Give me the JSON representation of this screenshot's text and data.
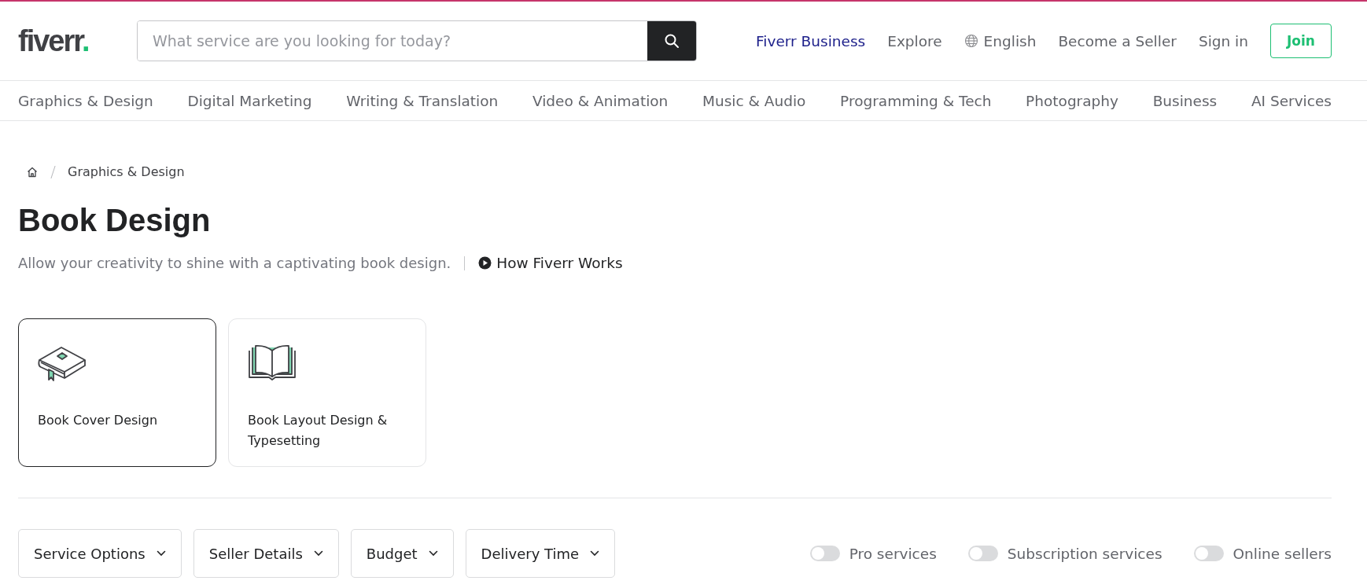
{
  "logo": {
    "text": "fiverr",
    "dot": "."
  },
  "search": {
    "placeholder": "What service are you looking for today?"
  },
  "nav": [
    {
      "label": "Fiverr Business",
      "kind": "highlight"
    },
    {
      "label": "Explore",
      "kind": "plain"
    },
    {
      "label": "English",
      "kind": "language"
    },
    {
      "label": "Become a Seller",
      "kind": "plain"
    },
    {
      "label": "Sign in",
      "kind": "plain"
    }
  ],
  "join_button": "Join",
  "categories": [
    "Graphics & Design",
    "Digital Marketing",
    "Writing & Translation",
    "Video & Animation",
    "Music & Audio",
    "Programming & Tech",
    "Photography",
    "Business",
    "AI Services"
  ],
  "breadcrumb": [
    "Graphics & Design"
  ],
  "title": "Book Design",
  "subtitle": "Allow your creativity to shine with a captivating book design.",
  "how_link": "How Fiverr Works",
  "subcategories": [
    {
      "label": "Book Cover Design",
      "kind": "cover",
      "selected": true
    },
    {
      "label": "Book Layout Design & Typesetting",
      "kind": "layout",
      "selected": false
    }
  ],
  "filters": [
    "Service Options",
    "Seller Details",
    "Budget",
    "Delivery Time"
  ],
  "toggles": [
    {
      "label": "Pro services",
      "on": false
    },
    {
      "label": "Subscription services",
      "on": false
    },
    {
      "label": "Online sellers",
      "on": false
    }
  ]
}
